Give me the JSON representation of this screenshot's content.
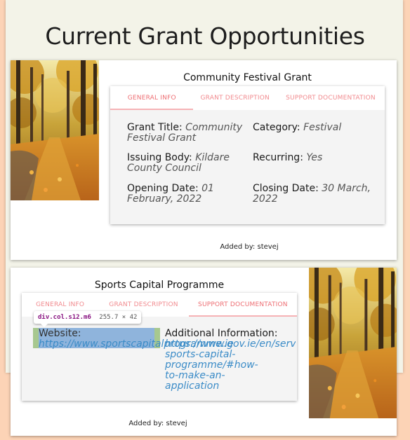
{
  "page": {
    "title": "Current Grant Opportunities"
  },
  "colors": {
    "background": "#fcd3b6",
    "panel": "#f3f3e8",
    "tab_accent": "#ee6e73",
    "link": "#3a8bc7"
  },
  "grants": [
    {
      "title": "Community Festival Grant",
      "tabs": [
        "GENERAL INFO",
        "GRANT DESCRIPTION",
        "SUPPORT DOCUMENTATION"
      ],
      "active_tab": "GENERAL INFO",
      "fields": {
        "grant_title_label": "Grant Title:",
        "grant_title_value": "Community Festival Grant",
        "category_label": "Category:",
        "category_value": "Festival",
        "issuing_body_label": "Issuing Body:",
        "issuing_body_value": "Kildare County Council",
        "recurring_label": "Recurring:",
        "recurring_value": "Yes",
        "opening_date_label": "Opening Date:",
        "opening_date_value": "01 February, 2022",
        "closing_date_label": "Closing Date:",
        "closing_date_value": "30 March, 2022"
      },
      "added_by": "Added by: stevej",
      "image_icon": "autumn-forest-path-photo"
    },
    {
      "title": "Sports Capital Programme",
      "tabs": [
        "GENERAL INFO",
        "GRANT DESCRIPTION",
        "SUPPORT DOCUMENTATION"
      ],
      "active_tab": "SUPPORT DOCUMENTATION",
      "fields": {
        "website_label": "Website:",
        "website_value": "https://www.sportscapitalprogramme.ie",
        "additional_label": "Additional Information:",
        "additional_value": "https://www.gov.ie/en/service/d sports-capital-programme/#how-to-make-an-application"
      },
      "added_by": "Added by: stevej",
      "image_icon": "autumn-forest-path-photo"
    }
  ],
  "devtools_tooltip": {
    "selector": "div.col.s12.m6",
    "dimensions": "255.7 × 42"
  }
}
